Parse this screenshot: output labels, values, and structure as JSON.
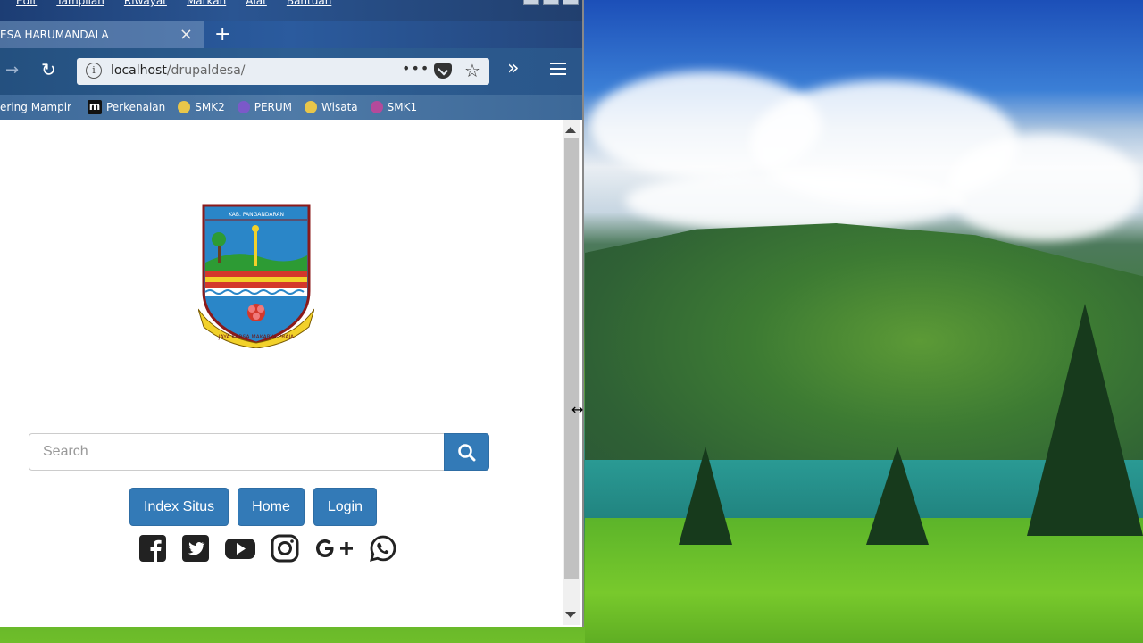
{
  "menu": [
    "Edit",
    "Tampilan",
    "Riwayat",
    "Markah",
    "Alat",
    "Bantuan"
  ],
  "tab": {
    "title": "ESA HARUMANDALA",
    "close": "×",
    "new_tab": "+"
  },
  "url": {
    "host": "localhost",
    "path": "/drupaldesa/"
  },
  "bookmarks": [
    {
      "label": "ering Mampir",
      "color": "#4b77b0"
    },
    {
      "label": "Perkenalan",
      "color": "#111111"
    },
    {
      "label": "SMK2",
      "color": "#e8c64a"
    },
    {
      "label": "PERUM",
      "color": "#7b59c9"
    },
    {
      "label": "Wisata",
      "color": "#e8c64a"
    },
    {
      "label": "SMK1",
      "color": "#b44a9b"
    }
  ],
  "logo": {
    "top_text": "KAB. PANGANDARAN",
    "ribbon": "JAYA KARSA MAKARYA PRAJA"
  },
  "search": {
    "placeholder": "Search",
    "icon": "search-icon"
  },
  "buttons": {
    "index": "Index Situs",
    "home": "Home",
    "login": "Login"
  },
  "social": [
    "facebook-icon",
    "twitter-icon",
    "youtube-icon",
    "instagram-icon",
    "google-plus-icon",
    "whatsapp-icon"
  ],
  "colors": {
    "primary": "#337ab7"
  }
}
